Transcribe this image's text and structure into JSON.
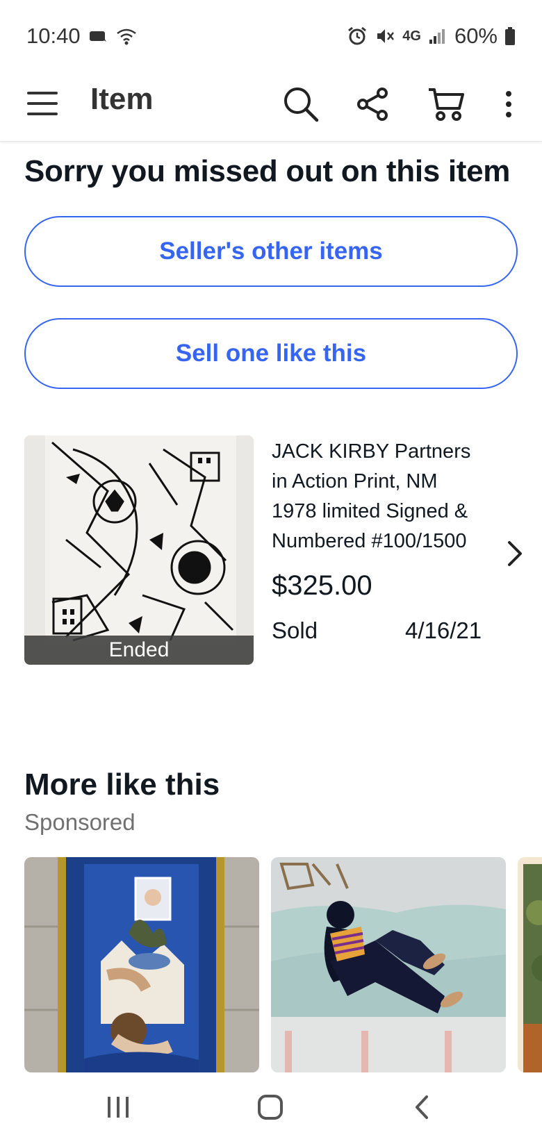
{
  "status_bar": {
    "time": "10:40",
    "network": "4G",
    "battery": "60%"
  },
  "app_bar": {
    "title": "Item",
    "icons": [
      "menu-icon",
      "search-icon",
      "share-icon",
      "cart-icon",
      "more-vert-icon"
    ]
  },
  "heading": "Sorry you missed out on this item",
  "buttons": {
    "seller_other": "Seller's other items",
    "sell_one": "Sell one like this"
  },
  "item": {
    "title_lines": [
      "JACK KIRBY Partners",
      "in Action Print, NM",
      "1978 limited Signed &",
      "Numbered #100/1500"
    ],
    "price": "$325.00",
    "status": "Sold",
    "date": "4/16/21",
    "badge": "Ended"
  },
  "more": {
    "title": "More like this",
    "subtitle": "Sponsored"
  },
  "colors": {
    "accent": "#3665f3",
    "text": "#111820",
    "muted": "#707070"
  }
}
